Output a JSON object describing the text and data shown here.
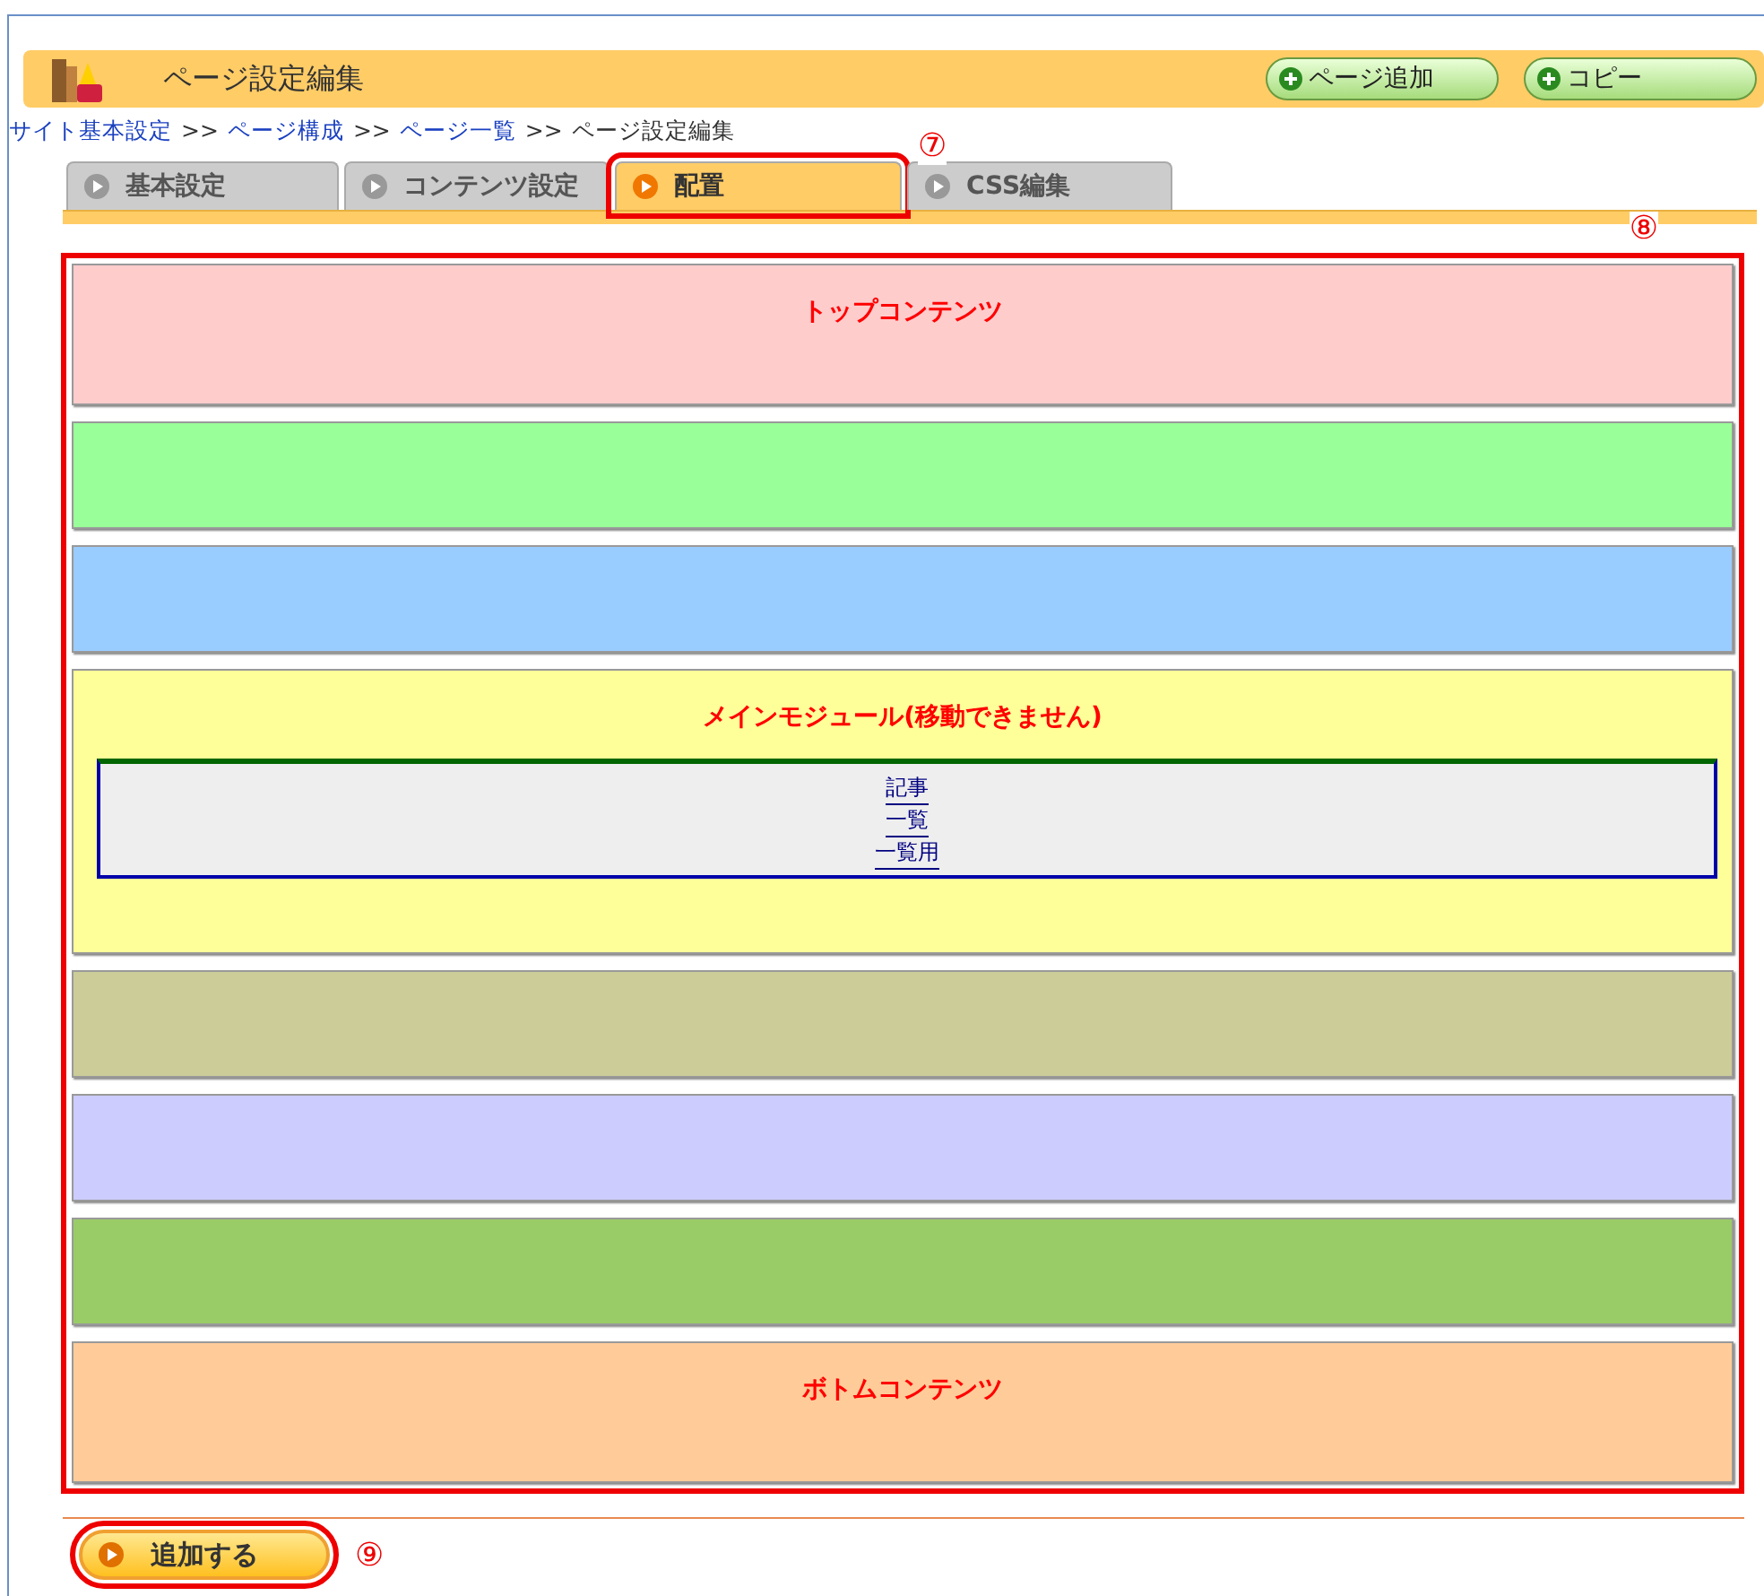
{
  "header": {
    "title": "ページ設定編集",
    "buttons": [
      {
        "label": "ページ追加"
      },
      {
        "label": "コピー"
      }
    ]
  },
  "breadcrumb": {
    "separator": ">>",
    "links": [
      "サイト基本設定",
      "ページ構成",
      "ページ一覧"
    ],
    "current": "ページ設定編集"
  },
  "tabs": [
    {
      "label": "基本設定",
      "selected": false,
      "highlighted": false
    },
    {
      "label": "コンテンツ設定",
      "selected": false,
      "highlighted": false
    },
    {
      "label": "配置",
      "selected": true,
      "highlighted": true,
      "callout": "⑦"
    },
    {
      "label": "CSS編集",
      "selected": false,
      "highlighted": false
    }
  ],
  "layout": {
    "highlighted": true,
    "callout": "⑧",
    "zones": [
      {
        "label": "トップコンテンツ",
        "color": "#ffcccc",
        "tall": false
      },
      {
        "color": "#99ff99",
        "tall": false
      },
      {
        "color": "#99ccff",
        "tall": false
      },
      {
        "label": "メインモジュール(移動できません)",
        "color": "#ffff99",
        "tall": true,
        "module_links": [
          "記事",
          "一覧",
          "一覧用"
        ]
      },
      {
        "color": "#cccc99",
        "tall": false
      },
      {
        "color": "#ccccff",
        "tall": false
      },
      {
        "color": "#99cc66",
        "tall": false
      },
      {
        "label": "ボトムコンテンツ",
        "color": "#ffcc99",
        "tall": false
      }
    ]
  },
  "add_button": {
    "label": "追加する",
    "highlighted": true,
    "callout": "⑨"
  }
}
